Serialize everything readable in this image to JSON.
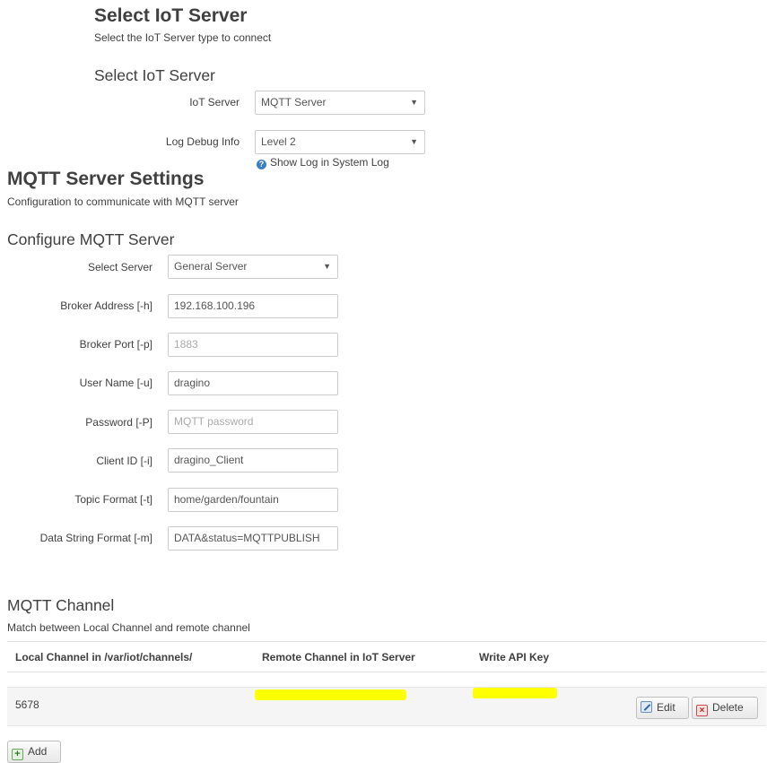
{
  "iot": {
    "title": "Select IoT Server",
    "description": "Select the IoT Server type to connect",
    "section_title": "Select IoT Server",
    "server_label": "IoT Server",
    "server_value": "MQTT Server",
    "log_label": "Log Debug Info",
    "log_value": "Level 2",
    "log_help": "Show Log in System Log"
  },
  "mqtt": {
    "title": "MQTT Server Settings",
    "description": "Configuration to communicate with MQTT server",
    "section_title": "Configure MQTT Server",
    "fields": [
      {
        "label": "Select Server",
        "value": "General Server",
        "placeholder": ""
      },
      {
        "label": "Broker Address [-h]",
        "value": "192.168.100.196",
        "placeholder": ""
      },
      {
        "label": "Broker Port [-p]",
        "value": "",
        "placeholder": "1883"
      },
      {
        "label": "User Name [-u]",
        "value": "dragino",
        "placeholder": ""
      },
      {
        "label": "Password [-P]",
        "value": "",
        "placeholder": "MQTT password"
      },
      {
        "label": "Client ID [-i]",
        "value": "dragino_Client",
        "placeholder": ""
      },
      {
        "label": "Topic Format [-t]",
        "value": "home/garden/fountain",
        "placeholder": ""
      },
      {
        "label": "Data String Format [-m]",
        "value": "DATA&status=MQTTPUBLISH",
        "placeholder": ""
      }
    ]
  },
  "channel": {
    "title": "MQTT Channel",
    "description": "Match between Local Channel and remote channel",
    "columns": [
      "Local Channel in /var/iot/channels/",
      "Remote Channel in IoT Server",
      "Write API Key"
    ],
    "rows": [
      {
        "local": "5678",
        "remote": "",
        "api_key": ""
      }
    ],
    "edit_label": "Edit",
    "delete_label": "Delete",
    "add_label": "Add"
  },
  "colors": {
    "highlight": "#ffff00",
    "help_icon": "#3a7fc1"
  }
}
